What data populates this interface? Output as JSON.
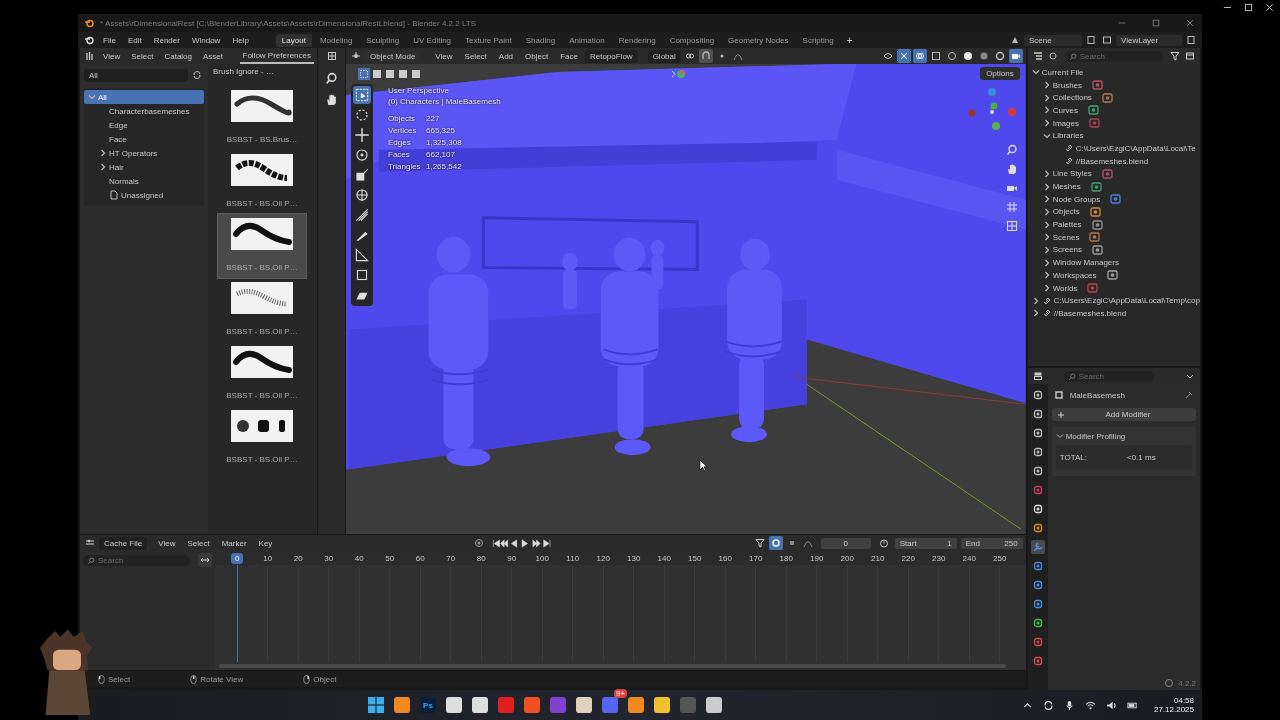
{
  "window": {
    "title": "* Assets\\rDimensionalRest [C:\\BlenderLibrary\\Assets\\Assets\\rDimensionalRestLblend] - Blender 4.2.2 LTS"
  },
  "menus": [
    "File",
    "Edit",
    "Render",
    "Window",
    "Help"
  ],
  "workspaces": [
    {
      "label": "Layout",
      "selected": true
    },
    {
      "label": "Modeling",
      "selected": false
    },
    {
      "label": "Sculpting",
      "selected": false
    },
    {
      "label": "UV Editing",
      "selected": false
    },
    {
      "label": "Texture Paint",
      "selected": false
    },
    {
      "label": "Shading",
      "selected": false
    },
    {
      "label": "Animation",
      "selected": false
    },
    {
      "label": "Rendering",
      "selected": false
    },
    {
      "label": "Compositing",
      "selected": false
    },
    {
      "label": "Geometry Nodes",
      "selected": false
    },
    {
      "label": "Scripting",
      "selected": false
    }
  ],
  "add_workspace": "+",
  "scene": "Scene",
  "view_layer": "ViewLayer",
  "asset_browser": {
    "menus": [
      "View",
      "Select",
      "Catalog",
      "Asset"
    ],
    "library": "Follow Preferences",
    "filter": "All",
    "catalogs": [
      {
        "label": "All",
        "selected": true,
        "expanded": true,
        "children": [
          {
            "label": "Characterbasemeshes",
            "selected": false
          },
          {
            "label": "Edge",
            "selected": false
          },
          {
            "label": "Face",
            "selected": false
          },
          {
            "label": "HT Operators",
            "selected": false,
            "expanded": false
          },
          {
            "label": "Hair",
            "selected": false,
            "expanded": false
          },
          {
            "label": "Normals",
            "selected": false
          },
          {
            "label": "Unassigned",
            "selected": false,
            "kind": "unassigned"
          }
        ]
      }
    ],
    "brush_list_title": "Brush Ignore - …",
    "brushes": [
      {
        "label": "BSBST - BS.Brus…",
        "selected": false,
        "kind": "soft"
      },
      {
        "label": "BSBST - BS.Oil P…",
        "selected": false,
        "kind": "rough"
      },
      {
        "label": "BSBST - BS.Oil P…",
        "selected": true,
        "kind": "solid"
      },
      {
        "label": "BSBST - BS.Oil P…",
        "selected": false,
        "kind": "dry"
      },
      {
        "label": "BSBST - BS.Oil P…",
        "selected": false,
        "kind": "solid"
      },
      {
        "label": "BSBST - BS.Oil P…",
        "selected": false,
        "kind": "stamps"
      }
    ]
  },
  "viewport": {
    "mode": "Object Mode",
    "menus": [
      "View",
      "Select",
      "Add",
      "Object",
      "Face"
    ],
    "addon_menu": "RetopoFlow",
    "orientation": "Global",
    "options": "Options",
    "view_name": "User Perspective",
    "context": "(0) Characters | MaleBasemesh",
    "stats": [
      {
        "label": "Objects",
        "value": "227"
      },
      {
        "label": "Vertices",
        "value": "665,325"
      },
      {
        "label": "Edges",
        "value": "1,325,308"
      },
      {
        "label": "Faces",
        "value": "662,107"
      },
      {
        "label": "Triangles",
        "value": "1,265,542"
      }
    ],
    "tools": [
      {
        "kind": "select",
        "selected": true
      },
      {
        "kind": "cursor",
        "selected": false
      },
      {
        "kind": "move",
        "selected": false
      },
      {
        "kind": "rotate",
        "selected": false
      },
      {
        "kind": "scale",
        "selected": false
      },
      {
        "kind": "transform",
        "selected": false
      },
      {
        "kind": "annotate",
        "selected": false
      },
      {
        "kind": "draw",
        "selected": false
      },
      {
        "kind": "measure",
        "selected": false
      },
      {
        "kind": "cube",
        "selected": false
      },
      {
        "kind": "extrude",
        "selected": false
      }
    ]
  },
  "outliner": {
    "search_placeholder": "Search",
    "tree": [
      {
        "label": "Current File",
        "kind": "file",
        "expanded": true,
        "children": [
          {
            "label": "Brushes",
            "kind": "brushes",
            "expanded": false
          },
          {
            "label": "Collections",
            "kind": "collections",
            "expanded": false
          },
          {
            "label": "Curves",
            "kind": "curves",
            "expanded": false
          },
          {
            "label": "Images",
            "kind": "images",
            "expanded": false
          },
          {
            "label": "Libraries",
            "kind": "libraries",
            "expanded": true,
            "children": [
              {
                "label": "C:\\Users\\EzgiC\\AppData\\Local\\Te",
                "kind": "link"
              },
              {
                "label": "//Basemeshes.blend",
                "kind": "link"
              }
            ]
          },
          {
            "label": "Line Styles",
            "kind": "line_styles",
            "expanded": false
          },
          {
            "label": "Meshes",
            "kind": "meshes",
            "expanded": false
          },
          {
            "label": "Node Groups",
            "kind": "node_groups",
            "expanded": false
          },
          {
            "label": "Objects",
            "kind": "objects",
            "expanded": false
          },
          {
            "label": "Palettes",
            "kind": "palettes",
            "expanded": false
          },
          {
            "label": "Scenes",
            "kind": "scenes",
            "expanded": false
          },
          {
            "label": "Screens",
            "kind": "screens",
            "expanded": false
          },
          {
            "label": "Window Managers",
            "kind": "window_managers",
            "expanded": false
          },
          {
            "label": "Workspaces",
            "kind": "workspaces",
            "expanded": false
          },
          {
            "label": "Worlds",
            "kind": "worlds",
            "expanded": false
          }
        ]
      },
      {
        "label": "C:\\Users\\EzgiC\\AppData\\Local\\Temp\\cop",
        "kind": "link",
        "expanded": false
      },
      {
        "label": "//Basemeshes.blend",
        "kind": "link",
        "expanded": false
      }
    ]
  },
  "properties": {
    "search_placeholder": "Search",
    "object_name": "MaleBasemesh",
    "add_modifier": "Add Modifier",
    "panel": {
      "title": "Modifier Profiling",
      "expanded": true,
      "rows": [
        {
          "label": "TOTAL:",
          "value": "<0.1 ms"
        }
      ]
    },
    "tabs": [
      {
        "kind": "tool",
        "selected": false
      },
      {
        "kind": "render",
        "selected": false
      },
      {
        "kind": "output",
        "selected": false
      },
      {
        "kind": "view_layer",
        "selected": false
      },
      {
        "kind": "scene",
        "selected": false
      },
      {
        "kind": "world",
        "selected": false
      },
      {
        "kind": "collection",
        "selected": false
      },
      {
        "kind": "object",
        "selected": false
      },
      {
        "kind": "modifiers",
        "selected": true
      },
      {
        "kind": "particles",
        "selected": false
      },
      {
        "kind": "physics",
        "selected": false
      },
      {
        "kind": "constraints",
        "selected": false
      },
      {
        "kind": "data",
        "selected": false
      },
      {
        "kind": "material",
        "selected": false
      },
      {
        "kind": "texture",
        "selected": false
      }
    ]
  },
  "timeline": {
    "editor": "Cache File",
    "menus": [
      "View",
      "Select",
      "Marker",
      "Key"
    ],
    "current_frame": "0",
    "start_label": "Start",
    "start": "1",
    "end_label": "End",
    "end": "250",
    "search_placeholder": "Search",
    "ruler": [
      {
        "label": "0",
        "current": true
      },
      {
        "label": "10",
        "current": false
      },
      {
        "label": "20",
        "current": false
      },
      {
        "label": "30",
        "current": false
      },
      {
        "label": "40",
        "current": false
      },
      {
        "label": "50",
        "current": false
      },
      {
        "label": "60",
        "current": false
      },
      {
        "label": "70",
        "current": false
      },
      {
        "label": "80",
        "current": false
      },
      {
        "label": "90",
        "current": false
      },
      {
        "label": "100",
        "current": false
      },
      {
        "label": "110",
        "current": false
      },
      {
        "label": "120",
        "current": false
      },
      {
        "label": "130",
        "current": false
      },
      {
        "label": "140",
        "current": false
      },
      {
        "label": "150",
        "current": false
      },
      {
        "label": "160",
        "current": false
      },
      {
        "label": "170",
        "current": false
      },
      {
        "label": "180",
        "current": false
      },
      {
        "label": "190",
        "current": false
      },
      {
        "label": "200",
        "current": false
      },
      {
        "label": "210",
        "current": false
      },
      {
        "label": "220",
        "current": false
      },
      {
        "label": "230",
        "current": false
      },
      {
        "label": "240",
        "current": false
      },
      {
        "label": "250",
        "current": false
      }
    ]
  },
  "status_bar": {
    "items": [
      {
        "kind": "mouse-left",
        "label": "Select"
      },
      {
        "kind": "mouse-middle",
        "label": "Rotate View"
      },
      {
        "kind": "mouse-right",
        "label": "Object"
      }
    ],
    "version": "4.2.2"
  },
  "taskbar": {
    "apps": [
      {
        "kind": "start"
      },
      {
        "kind": "blender"
      },
      {
        "kind": "photoshop",
        "label": "Ps"
      },
      {
        "kind": "tool"
      },
      {
        "kind": "tool"
      },
      {
        "kind": "opera"
      },
      {
        "kind": "brave"
      },
      {
        "kind": "video"
      },
      {
        "kind": "image"
      },
      {
        "kind": "chat",
        "badge": "9+"
      },
      {
        "kind": "blender"
      },
      {
        "kind": "folder"
      },
      {
        "kind": "game"
      },
      {
        "kind": "capture"
      }
    ],
    "clock": {
      "time": "04:58",
      "date": "27.12.2025"
    }
  }
}
